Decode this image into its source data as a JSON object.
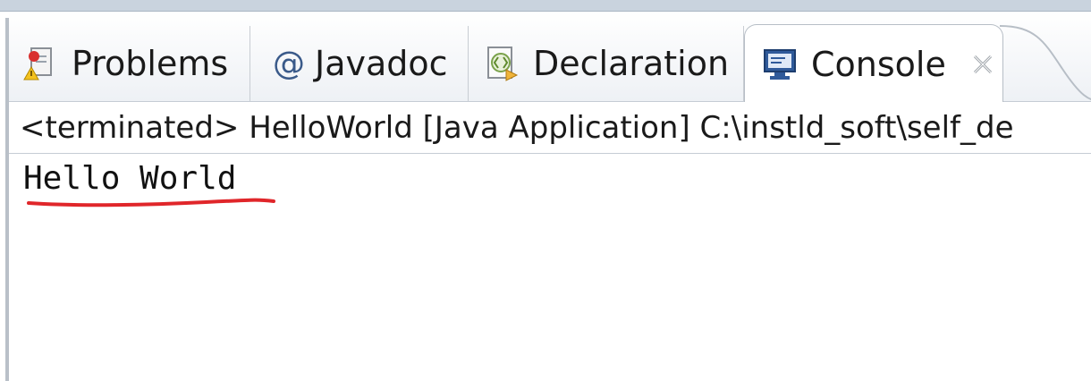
{
  "tabs": [
    {
      "label": "Problems",
      "icon": "problems-icon"
    },
    {
      "label": "Javadoc",
      "icon": "at-icon",
      "glyph": "@"
    },
    {
      "label": "Declaration",
      "icon": "declaration-icon"
    },
    {
      "label": "Console",
      "icon": "console-icon",
      "active": true
    }
  ],
  "status": {
    "text": "<terminated> HelloWorld [Java Application] C:\\instld_soft\\self_de"
  },
  "console": {
    "output": "Hello World"
  },
  "colors": {
    "underline": "#e0262a",
    "tab_border": "#b7bec6",
    "icon_blue": "#2f5a9a"
  }
}
